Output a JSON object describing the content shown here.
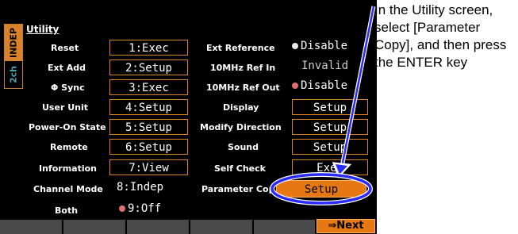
{
  "side_tab": {
    "mode": "INDEP",
    "channel": "2ch"
  },
  "title": "Utility",
  "left_rows": [
    {
      "label": "Reset",
      "value": "1:Exec"
    },
    {
      "label": "Ext Add",
      "value": "2:Setup"
    },
    {
      "label": "Φ Sync",
      "value": "3:Exec"
    },
    {
      "label": "User Unit",
      "value": "4:Setup"
    },
    {
      "label": "Power-On State",
      "value": "5:Setup"
    },
    {
      "label": "Remote",
      "value": "6:Setup"
    },
    {
      "label": "Information",
      "value": "7:View"
    },
    {
      "label": "Channel Mode",
      "value": "8:Indep"
    },
    {
      "label": "Both",
      "value": "9:Off"
    }
  ],
  "right_rows": [
    {
      "label": "Ext Reference",
      "value": "Disable"
    },
    {
      "label": "10MHz Ref In",
      "value": "Invalid"
    },
    {
      "label": "10MHz Ref Out",
      "value": "Disable"
    },
    {
      "label": "Display",
      "value": "Setup"
    },
    {
      "label": "Modify Direction",
      "value": "Setup"
    },
    {
      "label": "Sound",
      "value": "Setup"
    },
    {
      "label": "Self Check",
      "value": "Exec"
    },
    {
      "label": "Parameter Copy",
      "value": "Setup"
    }
  ],
  "softkeys": {
    "next_label": "⇒Next"
  },
  "callout": {
    "text": "In the Utility screen, select [Parameter Copy], and then press the ENTER key"
  },
  "colors": {
    "accent": "#e67814",
    "frame": "#d9822b",
    "highlight_ring": "#2a2aff"
  }
}
